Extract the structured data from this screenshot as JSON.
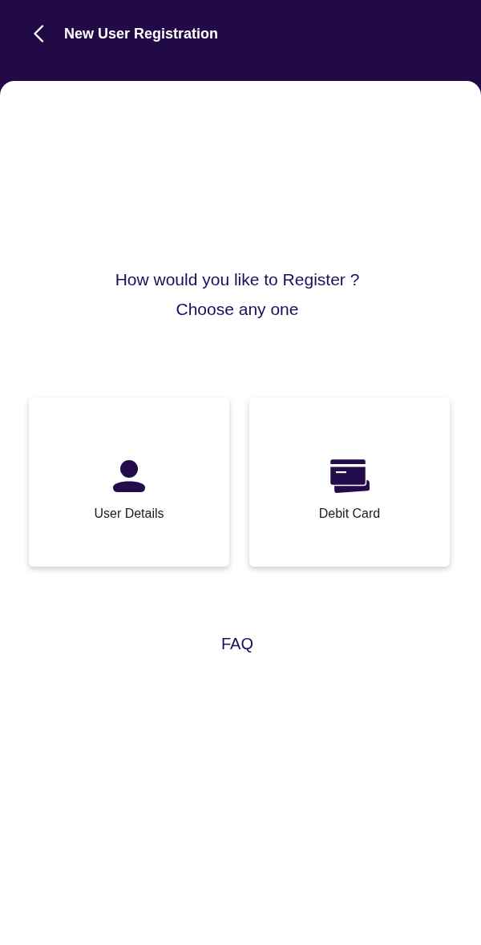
{
  "header": {
    "title": "New User Registration"
  },
  "prompt": {
    "question": "How would you like to Register ?",
    "instruction": "Choose any one"
  },
  "options": [
    {
      "kind": "user",
      "label": "User Details"
    },
    {
      "kind": "card",
      "label": "Debit Card"
    }
  ],
  "faq_link": "FAQ"
}
